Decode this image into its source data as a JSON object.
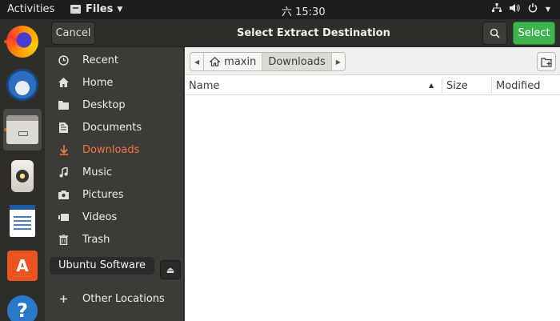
{
  "topbar": {
    "activities": "Activities",
    "app_menu": "Files",
    "clock": "六 15:30",
    "tray_icons": [
      "network-icon",
      "volume-icon",
      "power-icon"
    ]
  },
  "dock": {
    "items": [
      {
        "name": "firefox"
      },
      {
        "name": "thunderbird"
      },
      {
        "name": "files",
        "active": true
      },
      {
        "name": "rhythmbox"
      },
      {
        "name": "libreoffice-writer"
      },
      {
        "name": "ubuntu-software"
      },
      {
        "name": "help"
      }
    ],
    "tooltip": "Ubuntu Software"
  },
  "dialog": {
    "title": "Select Extract Destination",
    "cancel_label": "Cancel",
    "select_label": "Select"
  },
  "sidebar": {
    "places": [
      {
        "label": "Recent",
        "icon": "clock-icon"
      },
      {
        "label": "Home",
        "icon": "home-icon"
      },
      {
        "label": "Desktop",
        "icon": "folder-icon"
      },
      {
        "label": "Documents",
        "icon": "document-icon"
      },
      {
        "label": "Downloads",
        "icon": "download-icon",
        "current": true
      },
      {
        "label": "Music",
        "icon": "music-icon"
      },
      {
        "label": "Pictures",
        "icon": "camera-icon"
      },
      {
        "label": "Videos",
        "icon": "video-icon"
      },
      {
        "label": "Trash",
        "icon": "trash-icon"
      },
      {
        "label": "Other Locations",
        "icon": "plus-icon"
      }
    ]
  },
  "pathbar": {
    "home": "maxin",
    "current": "Downloads"
  },
  "columns": {
    "name": "Name",
    "size": "Size",
    "modified": "Modified"
  },
  "colors": {
    "accent": "#f07746",
    "select_button": "#3eb34f",
    "dock_running": "#e95420"
  }
}
